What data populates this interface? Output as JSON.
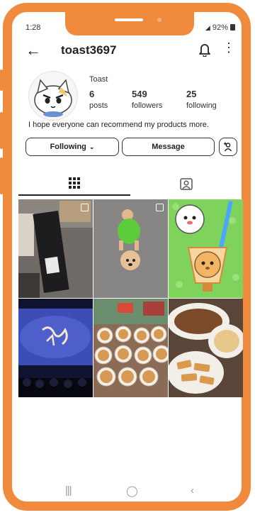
{
  "status_bar": {
    "time": "1:28",
    "battery": "92%"
  },
  "header": {
    "username": "toast3697"
  },
  "profile": {
    "display_name": "Toast",
    "stats": [
      {
        "value": "6",
        "label": "posts"
      },
      {
        "value": "549",
        "label": "followers"
      },
      {
        "value": "25",
        "label": "following"
      }
    ],
    "bio": "I hope everyone can recommend my products more."
  },
  "actions": {
    "following_label": "Following",
    "message_label": "Message"
  },
  "tabs": [
    {
      "name": "posts-grid-tab",
      "icon": "grid-icon",
      "active": true
    },
    {
      "name": "tagged-tab",
      "icon": "tagged-person-icon",
      "active": false
    }
  ],
  "posts": [
    {
      "subject": "dark product package",
      "multi": true
    },
    {
      "subject": "poodle in green shirt",
      "multi": true
    },
    {
      "subject": "cartoon puppies and drink",
      "multi": false
    },
    {
      "subject": "cinema screen",
      "multi": false
    },
    {
      "subject": "bowls of food",
      "multi": false
    },
    {
      "subject": "dishes of food",
      "multi": false
    }
  ],
  "colors": {
    "frame": "#f08a3c",
    "text": "#222222"
  }
}
